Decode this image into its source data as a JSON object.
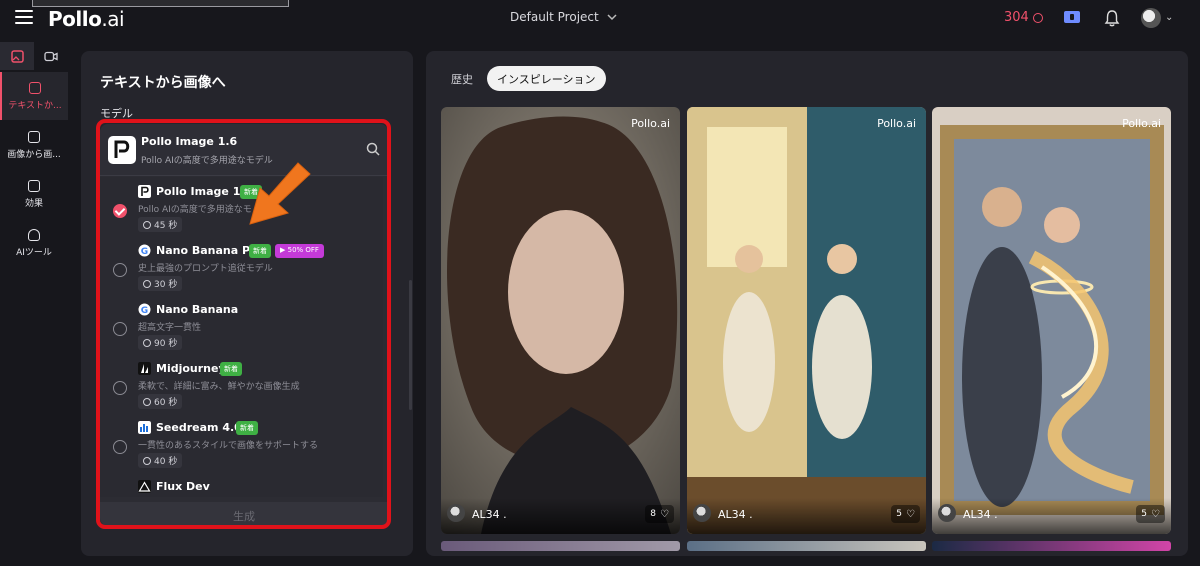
{
  "header": {
    "logo_main": "Pollo",
    "logo_suffix": ".ai",
    "project": "Default Project",
    "credits": "304"
  },
  "rail": {
    "items": [
      {
        "label": "テキストか..."
      },
      {
        "label": "画像から画..."
      },
      {
        "label": "効果"
      },
      {
        "label": "AIツール"
      }
    ]
  },
  "panel": {
    "title": "テキストから画像へ",
    "model_label": "モデル",
    "generate_label": "生成"
  },
  "selected_model": {
    "name": "Pollo Image 1.6",
    "desc": "Pollo AIの高度で多用途なモデル"
  },
  "models": [
    {
      "name": "Pollo Image 1.6",
      "badge_new": "新着",
      "badge_off": "",
      "desc": "Pollo AIの高度で多用途なモ",
      "time": "45 秒",
      "checked": true
    },
    {
      "name": "Nano Banana Pro",
      "badge_new": "新着",
      "badge_off": "50% OFF",
      "desc": "史上最強のプロンプト追従モデル",
      "time": "30 秒",
      "checked": false
    },
    {
      "name": "Nano Banana",
      "badge_new": "",
      "badge_off": "",
      "desc": "超高文字一貫性",
      "time": "90 秒",
      "checked": false
    },
    {
      "name": "Midjourney",
      "badge_new": "新着",
      "badge_off": "",
      "desc": "柔軟で、詳細に富み、鮮やかな画像生成",
      "time": "60 秒",
      "checked": false
    },
    {
      "name": "Seedream 4.0",
      "badge_new": "新着",
      "badge_off": "",
      "desc": "一貫性のあるスタイルで画像をサポートする",
      "time": "40 秒",
      "checked": false
    }
  ],
  "partial_model": "Flux Dev",
  "tabs": [
    {
      "label": "歴史",
      "active": false
    },
    {
      "label": "インスピレーション",
      "active": true
    }
  ],
  "gallery": [
    {
      "watermark": "Pollo",
      "watermark_suffix": ".ai",
      "user": "AL34 .",
      "likes": "8"
    },
    {
      "watermark": "Pollo",
      "watermark_suffix": ".ai",
      "user": "AL34 .",
      "likes": "5"
    },
    {
      "watermark": "Pollo",
      "watermark_suffix": ".ai",
      "user": "AL34 .",
      "likes": "5"
    }
  ],
  "colors": {
    "accent": "#f0516b",
    "highlight_box": "#e0121a",
    "arrow": "#f0761e",
    "badge_new": "#3fb044",
    "badge_off": "#c43ad8"
  }
}
